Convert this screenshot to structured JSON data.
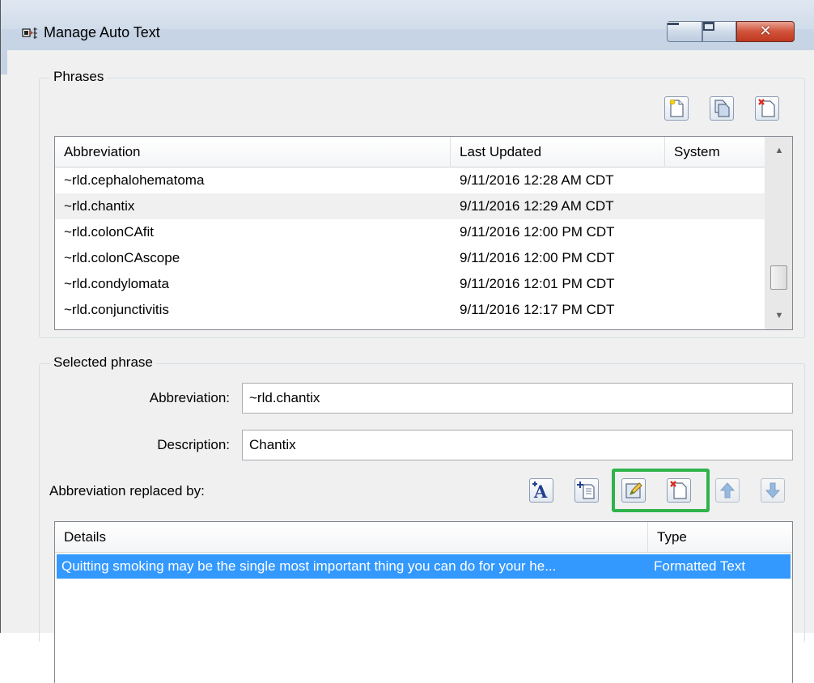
{
  "window": {
    "title": "Manage Auto Text",
    "controls": {
      "minimize": "minimize",
      "maximize": "maximize",
      "close": "✕"
    }
  },
  "phrases": {
    "legend": "Phrases",
    "toolbar": [
      "new-phrase-icon",
      "copy-phrase-icon",
      "delete-phrase-icon"
    ],
    "columns": [
      "Abbreviation",
      "Last Updated",
      "System"
    ],
    "rows": [
      {
        "abbreviation": "~rld.cephalohematoma",
        "last_updated": "9/11/2016 12:28 AM CDT",
        "system": ""
      },
      {
        "abbreviation": "~rld.chantix",
        "last_updated": "9/11/2016 12:29 AM CDT",
        "system": ""
      },
      {
        "abbreviation": "~rld.colonCAfit",
        "last_updated": "9/11/2016 12:00 PM CDT",
        "system": ""
      },
      {
        "abbreviation": "~rld.colonCAscope",
        "last_updated": "9/11/2016 12:00 PM CDT",
        "system": ""
      },
      {
        "abbreviation": "~rld.condylomata",
        "last_updated": "9/11/2016 12:01 PM CDT",
        "system": ""
      },
      {
        "abbreviation": "~rld.conjunctivitis",
        "last_updated": "9/11/2016 12:17 PM CDT",
        "system": ""
      }
    ],
    "selected_row": 1
  },
  "selected_phrase": {
    "legend": "Selected phrase",
    "abbreviation_label": "Abbreviation:",
    "abbreviation_value": "~rld.chantix",
    "description_label": "Description:",
    "description_value": "Chantix",
    "replaced_by_label": "Abbreviation replaced by:",
    "toolbar": [
      "add-formatted-text-icon",
      "add-template-icon",
      "edit-item-icon",
      "delete-item-icon",
      "move-up-icon",
      "move-down-icon"
    ],
    "details_columns": [
      "Details",
      "Type"
    ],
    "details_rows": [
      {
        "details": "Quitting smoking may be the single most important thing you can do for your he...",
        "type": "Formatted Text"
      }
    ]
  },
  "colors": {
    "selection": "#3399ff",
    "highlight": "#2fb34a",
    "hover_row": "#e5f3fb"
  }
}
